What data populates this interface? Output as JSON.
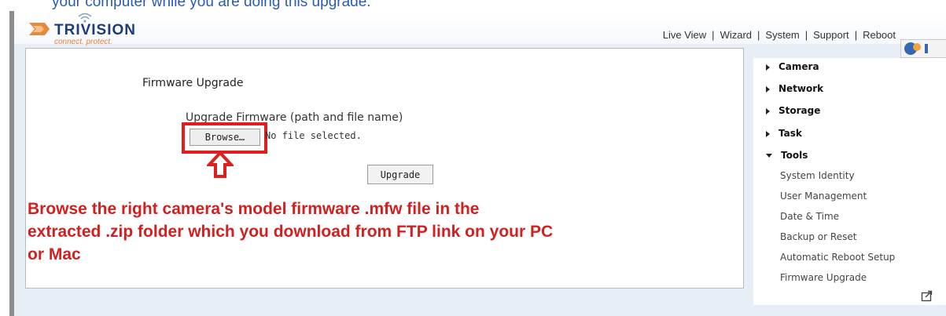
{
  "caption": "your computer while you are doing this upgrade.",
  "brand": {
    "name": "TRIVISION",
    "tagline": "connect. protect."
  },
  "topnav": {
    "items": [
      "Live View",
      "Wizard",
      "System",
      "Support",
      "Reboot"
    ],
    "separator": "|"
  },
  "main": {
    "title": "Firmware Upgrade",
    "upgrade_label": "Upgrade Firmware (path and file name)",
    "browse_label": "Browse…",
    "file_status": "No file selected.",
    "upgrade_button": "Upgrade"
  },
  "annotation": {
    "lines": [
      "Browse the right camera's model firmware .mfw file in the",
      "extracted .zip folder which you download from FTP link on your PC",
      "or Mac"
    ],
    "color": "#d21f1f"
  },
  "sidebar": {
    "sections": [
      "Camera",
      "Network",
      "Storage",
      "Task",
      "Tools"
    ],
    "tools_items": [
      "System Identity",
      "User Management",
      "Date & Time",
      "Backup or Reset",
      "Automatic Reboot Setup",
      "Firmware Upgrade"
    ]
  },
  "icons": [
    "wifi-icon",
    "logo-icon",
    "arrow-up-icon",
    "export-icon",
    "badge-icon"
  ]
}
